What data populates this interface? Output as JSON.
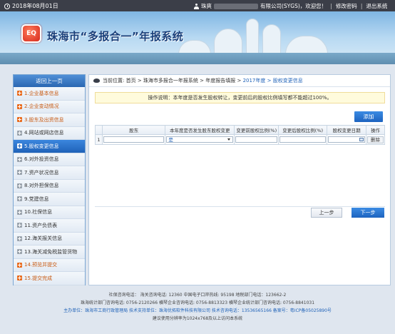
{
  "topbar": {
    "date": "2018年08月01日",
    "user_prefix": "珠爽",
    "user_company": "有限公司(SYGS)，欢迎您！",
    "change_password": "修改密码",
    "logout": "退出系统"
  },
  "banner": {
    "logo_text": "EQ",
    "system_title": "珠海市“多报合一”年报系统"
  },
  "sidebar": {
    "back_label": "返回上一页",
    "items": [
      {
        "label": "1.企业基本信息",
        "state": "plus"
      },
      {
        "label": "2.企业变动情况",
        "state": "plus"
      },
      {
        "label": "3.股东及出资信息",
        "state": "plus"
      },
      {
        "label": "4.网站或网店信息",
        "state": "gray"
      },
      {
        "label": "5.股权变更信息",
        "state": "active"
      },
      {
        "label": "6.对外投资信息",
        "state": "gray"
      },
      {
        "label": "7.资产状况信息",
        "state": "gray"
      },
      {
        "label": "8.对外担保信息",
        "state": "gray"
      },
      {
        "label": "9.党建信息",
        "state": "gray"
      },
      {
        "label": "10.社保信息",
        "state": "gray"
      },
      {
        "label": "11.资产负债表",
        "state": "gray"
      },
      {
        "label": "12.海关报关信息",
        "state": "gray"
      },
      {
        "label": "13.海关减免税监管货物",
        "state": "gray"
      },
      {
        "label": "14.预览并提交",
        "state": "plus"
      },
      {
        "label": "15.提交完成",
        "state": "plus"
      }
    ]
  },
  "breadcrumb": {
    "prefix": "当前位置:",
    "path": "首页 > 珠海市多报合一年报系统 > 年度报告填报 >",
    "current": "2017年度 > 股权变更信息"
  },
  "notice": "操作说明：本年度是否发生股权转让，变更前后的股权比例填写都不能超过100%。",
  "add_button": "添加",
  "table": {
    "headers": [
      "",
      "股东",
      "本年度是否发生股东股权变更",
      "变更前股权比例(%)",
      "变更后股权比例(%)",
      "股权变更日期",
      "操作"
    ],
    "rows": [
      {
        "num": "1",
        "shareholder": "",
        "changed": "是",
        "before": "",
        "after": "",
        "date": "",
        "action": "删除"
      }
    ]
  },
  "buttons": {
    "prev": "上一步",
    "next": "下一步"
  },
  "footer": {
    "line1": "社保咨询电话：   海关咨询电话: 12360   中国电子口岸热线: 95198   地税部门电话：123662-2",
    "line2": "珠海统计部门咨询电话: 0756-2120266   横琴企业咨询电话: 0756-8813323   横琴企业统计部门咨询电话: 0756-8841031",
    "line3": "主办单位：珠海市工商行政管理局   技术支持单位：珠海优拓软件科技有限公司   技术咨询电话：13536565166   备案号：粤ICP备05025890号",
    "line4": "建议使用分辨率为1024x768及以上访问本系统"
  }
}
